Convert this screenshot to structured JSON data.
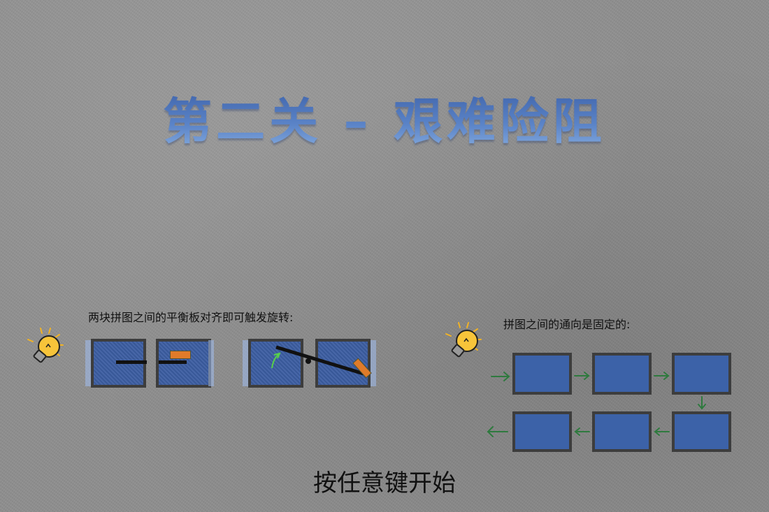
{
  "level": {
    "title": "第二关 – 艰难险阻"
  },
  "hints": {
    "rotate": "两块拼图之间的平衡板对齐即可触发旋转:",
    "route": "拼图之间的通向是固定的:"
  },
  "start": {
    "label": "按任意键开始"
  },
  "colors": {
    "panel": "#3c5da2",
    "frame": "#3d3d3d",
    "arrow": "#2e7a3e",
    "title": "#4a6eb2",
    "bulb": "#f2b324"
  },
  "icons": {
    "hint": "lightbulb-icon",
    "arrow": "arrow-icon"
  }
}
